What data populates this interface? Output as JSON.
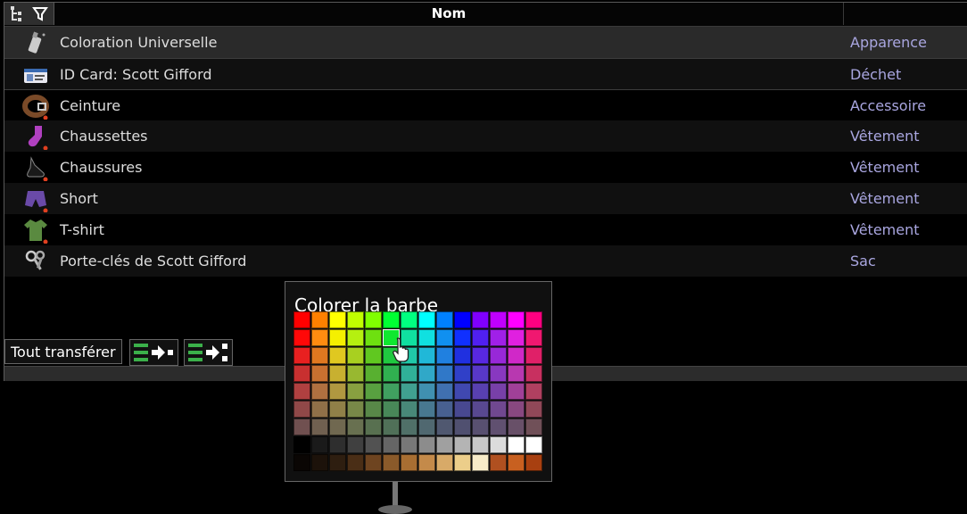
{
  "header": {
    "title": "Nom",
    "filter_icon": "filter-icon",
    "tree_icon": "tree-icon"
  },
  "items": [
    {
      "name": "Coloration Universelle",
      "type": "Apparence",
      "icon": "spray-can-icon",
      "selected": true
    },
    {
      "name": "ID Card: Scott Gifford",
      "type": "Déchet",
      "icon": "id-card-icon"
    },
    {
      "name": "Ceinture",
      "type": "Accessoire",
      "icon": "belt-icon"
    },
    {
      "name": "Chaussettes",
      "type": "Vêtement",
      "icon": "socks-icon"
    },
    {
      "name": "Chaussures",
      "type": "Vêtement",
      "icon": "shoes-icon"
    },
    {
      "name": "Short",
      "type": "Vêtement",
      "icon": "shorts-icon"
    },
    {
      "name": "T-shirt",
      "type": "Vêtement",
      "icon": "tshirt-icon"
    },
    {
      "name": "Porte-clés de Scott Gifford",
      "type": "Sac",
      "icon": "keys-icon"
    }
  ],
  "footer": {
    "transfer_all": "Tout transférer",
    "transfer_one_icon": "transfer-one-icon",
    "transfer_all_icon": "transfer-all-icon"
  },
  "color_picker": {
    "title": "Colorer la barbe",
    "rows": [
      [
        "#ff0000",
        "#ff8000",
        "#ffff00",
        "#c0ff00",
        "#80ff00",
        "#00ff33",
        "#00ff80",
        "#00ffff",
        "#0080ff",
        "#0000ff",
        "#8000ff",
        "#c000ff",
        "#ff00ff",
        "#ff0080"
      ],
      [
        "#ff0808",
        "#ff8c10",
        "#f5f000",
        "#b5f010",
        "#6ee010",
        "#10e830",
        "#10e0a0",
        "#10e0e0",
        "#1090f0",
        "#1030ff",
        "#5020f0",
        "#a020e8",
        "#e020e0",
        "#f01870"
      ],
      [
        "#e82020",
        "#e07820",
        "#e0c820",
        "#a8d020",
        "#60c820",
        "#20c840",
        "#20c8a8",
        "#20b8d8",
        "#2080e0",
        "#2030e0",
        "#5828e0",
        "#9828d8",
        "#d028c8",
        "#e02068"
      ],
      [
        "#c83030",
        "#c87030",
        "#c8b030",
        "#98b830",
        "#58b030",
        "#30b050",
        "#30b098",
        "#30a8c8",
        "#3078c8",
        "#3040c8",
        "#5838c8",
        "#8838c0",
        "#b838b0",
        "#c83060"
      ],
      [
        "#b04040",
        "#b07040",
        "#b09840",
        "#88a040",
        "#58a040",
        "#40a060",
        "#40a090",
        "#4090b0",
        "#4070b0",
        "#4048b0",
        "#5840b0",
        "#7840a8",
        "#a04098",
        "#b04060"
      ],
      [
        "#904848",
        "#907048",
        "#908048",
        "#788848",
        "#588848",
        "#488858",
        "#488878",
        "#487890",
        "#486090",
        "#484890",
        "#584890",
        "#704890",
        "#884880",
        "#904858"
      ],
      [
        "#705050",
        "#706050",
        "#706850",
        "#687050",
        "#587050",
        "#507058",
        "#507068",
        "#506870",
        "#505870",
        "#505070",
        "#585070",
        "#605070",
        "#685068",
        "#705058"
      ],
      [
        "#000000",
        "#1a1a1a",
        "#2e2e2e",
        "#404040",
        "#525252",
        "#656565",
        "#787878",
        "#8c8c8c",
        "#a0a0a0",
        "#b4b4b4",
        "#c8c8c8",
        "#dcdcdc",
        "#ffffff",
        "#ffffff"
      ],
      [
        "#0a0604",
        "#1c120a",
        "#2e1e10",
        "#4a2e16",
        "#6e4420",
        "#8a5a2a",
        "#a86e32",
        "#c48a4a",
        "#d8aa68",
        "#ecce8a",
        "#f8ecc8",
        "#b05020",
        "#c86020",
        "#a84010"
      ]
    ],
    "highlighted": [
      1,
      5
    ]
  },
  "colors": {
    "type_text": "#a9a6e0",
    "selected_row": "#2a2a2a"
  }
}
